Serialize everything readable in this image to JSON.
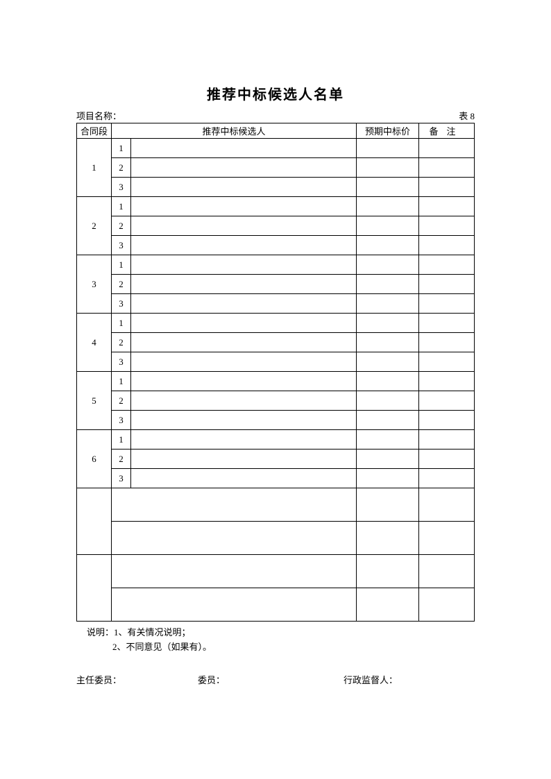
{
  "title": "推荐中标候选人名单",
  "top": {
    "project_label": "项目名称：",
    "table_no": "表 8"
  },
  "headers": {
    "section": "合同段",
    "candidate": "推荐中标候选人",
    "price": "预期中标价",
    "notes": "备注"
  },
  "sections": [
    "1",
    "2",
    "3",
    "4",
    "5",
    "6"
  ],
  "ranks": [
    "1",
    "2",
    "3"
  ],
  "explain": {
    "lead": "说明：",
    "item1": "1、有关情况说明；",
    "item2": "2、不同意见（如果有）。"
  },
  "sig": {
    "chair": "主任委员：",
    "member": "委员：",
    "supervisor": "行政监督人："
  }
}
